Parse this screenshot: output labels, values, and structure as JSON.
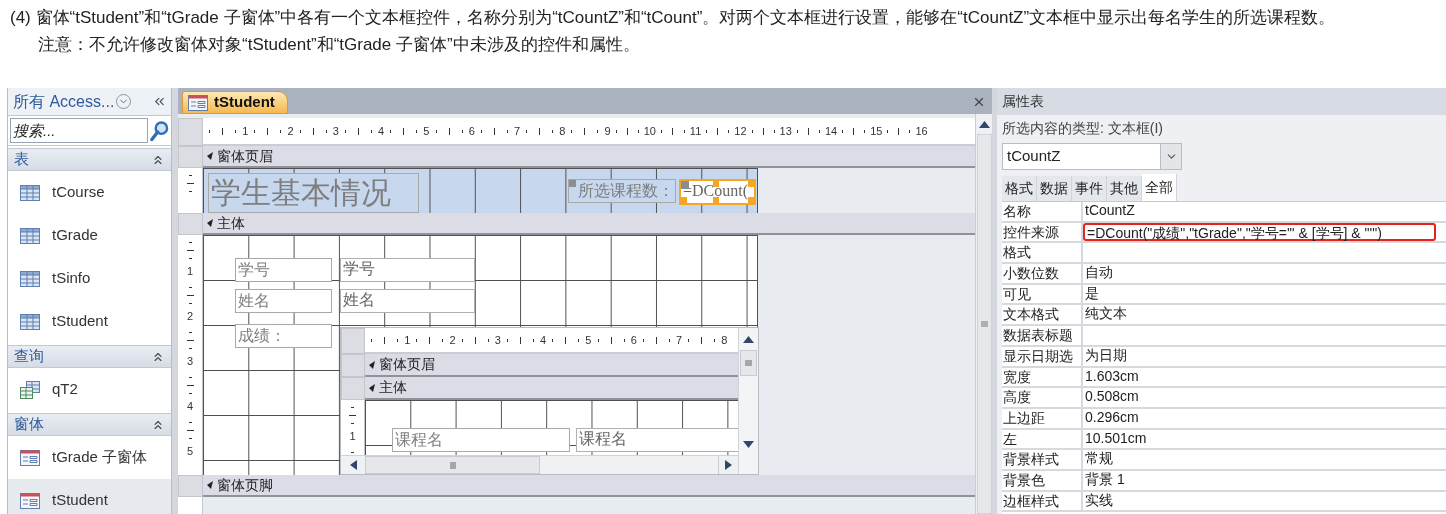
{
  "instructions": {
    "task": "(4) 窗体“tStudent”和“tGrade 子窗体”中各有一个文本框控件，名称分别为“tCountZ”和“tCount”。对两个文本框进行设置，能够在“tCountZ”文本框中显示出每名学生的所选课程数。",
    "note": "注意：不允许修改窗体对象“tStudent”和“tGrade 子窗体”中未涉及的控件和属性。"
  },
  "nav": {
    "title": "所有 Access...",
    "search_placeholder": "搜索...",
    "groups": [
      {
        "label": "表",
        "items": [
          {
            "label": "tCourse",
            "kind": "table",
            "selected": false
          },
          {
            "label": "tGrade",
            "kind": "table",
            "selected": false
          },
          {
            "label": "tSinfo",
            "kind": "table",
            "selected": false
          },
          {
            "label": "tStudent",
            "kind": "table",
            "selected": false
          }
        ]
      },
      {
        "label": "查询",
        "items": [
          {
            "label": "qT2",
            "kind": "query",
            "selected": false
          }
        ]
      },
      {
        "label": "窗体",
        "items": [
          {
            "label": "tGrade 子窗体",
            "kind": "form",
            "selected": false
          },
          {
            "label": "tStudent",
            "kind": "form",
            "selected": true
          }
        ]
      }
    ]
  },
  "document_tab": {
    "title": "tStudent"
  },
  "ruler_ticks": [
    "1",
    "2",
    "3",
    "4",
    "5",
    "6",
    "7",
    "8",
    "9",
    "10",
    "11",
    "12",
    "13",
    "14",
    "15",
    "16"
  ],
  "form": {
    "sections": [
      {
        "kind": "header",
        "label": "窗体页眉",
        "controls": [
          {
            "kind": "title",
            "text": "学生基本情况"
          },
          {
            "kind": "label",
            "text": "所选课程数："
          },
          {
            "kind": "textbox",
            "text": "=DCount(",
            "selected": true
          }
        ]
      },
      {
        "kind": "detail",
        "label": "主体",
        "ruler_ticks": [
          "1",
          "2",
          "3",
          "4",
          "5"
        ],
        "controls": [
          {
            "kind": "label",
            "text": "学号"
          },
          {
            "kind": "textbox",
            "text": "学号",
            "selected": false
          },
          {
            "kind": "label",
            "text": "姓名"
          },
          {
            "kind": "textbox",
            "text": "姓名",
            "selected": false
          },
          {
            "kind": "label",
            "text": "成绩："
          },
          {
            "kind": "subform",
            "ruler_ticks": [
              "1",
              "2",
              "3",
              "4",
              "5",
              "6",
              "7",
              "8"
            ],
            "sections": [
              {
                "kind": "header",
                "label": "窗体页眉"
              },
              {
                "kind": "detail",
                "label": "主体",
                "ruler_ticks": [
                  "1"
                ],
                "controls": [
                  {
                    "kind": "label",
                    "text": "课程名"
                  },
                  {
                    "kind": "textbox",
                    "text": "课程名",
                    "selected": false
                  }
                ]
              }
            ]
          }
        ]
      },
      {
        "kind": "footer",
        "label": "窗体页脚"
      }
    ]
  },
  "property_sheet": {
    "title": "属性表",
    "selection_type": "所选内容的类型: 文本框(I)",
    "object": "tCountZ",
    "tabs": [
      {
        "label": "格式",
        "selected": false
      },
      {
        "label": "数据",
        "selected": false
      },
      {
        "label": "事件",
        "selected": false
      },
      {
        "label": "其他",
        "selected": false
      },
      {
        "label": "全部",
        "selected": true
      }
    ],
    "rows": [
      {
        "name": "名称",
        "value": "tCountZ",
        "highlighted": false
      },
      {
        "name": "控件来源",
        "value": "=DCount(\"成绩\",\"tGrade\",\"学号='\" & [学号] & \"'\")",
        "highlighted": true
      },
      {
        "name": "格式",
        "highlighted": false
      },
      {
        "name": "小数位数",
        "value": "自动",
        "highlighted": false
      },
      {
        "name": "可见",
        "value": "是",
        "highlighted": false
      },
      {
        "name": "文本格式",
        "value": "纯文本",
        "highlighted": false
      },
      {
        "name": "数据表标题",
        "highlighted": false
      },
      {
        "name": "显示日期选",
        "value": "为日期",
        "highlighted": false
      },
      {
        "name": "宽度",
        "value": "1.603cm",
        "highlighted": false
      },
      {
        "name": "高度",
        "value": "0.508cm",
        "highlighted": false
      },
      {
        "name": "上边距",
        "value": "0.296cm",
        "highlighted": false
      },
      {
        "name": "左",
        "value": "10.501cm",
        "highlighted": false
      },
      {
        "name": "背景样式",
        "value": "常规",
        "highlighted": false
      },
      {
        "name": "背景色",
        "value": "背景 1",
        "highlighted": false
      },
      {
        "name": "边框样式",
        "value": "实线",
        "highlighted": false
      }
    ]
  }
}
